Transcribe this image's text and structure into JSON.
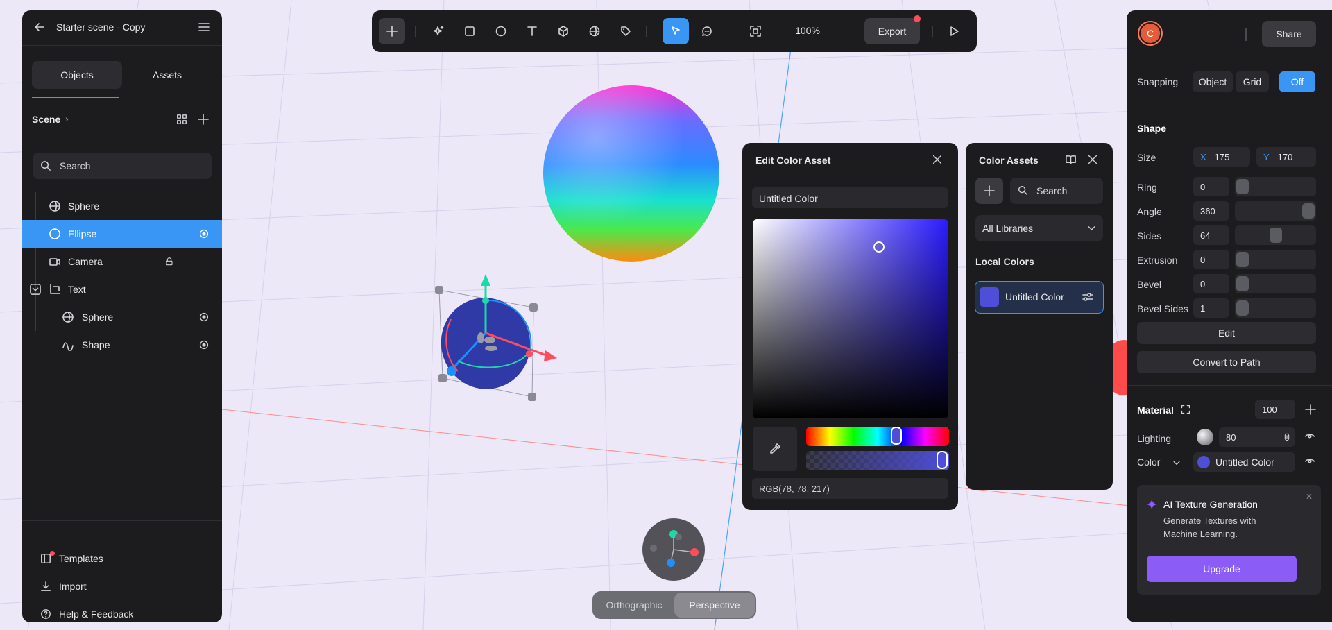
{
  "left_panel": {
    "title": "Starter scene - Copy",
    "tabs": [
      "Objects",
      "Assets"
    ],
    "scene_label": "Scene",
    "search_placeholder": "Search",
    "tree": [
      {
        "label": "Sphere",
        "icon": "sphere-icon"
      },
      {
        "label": "Ellipse",
        "icon": "ellipse-icon"
      },
      {
        "label": "Camera",
        "icon": "camera-icon"
      },
      {
        "label": "Text",
        "icon": "group-icon"
      },
      {
        "label": "Sphere",
        "icon": "sphere-icon"
      },
      {
        "label": "Shape",
        "icon": "shape-icon"
      }
    ],
    "bottom_links": [
      "Templates",
      "Import",
      "Help & Feedback"
    ]
  },
  "toolbar": {
    "zoom": "100%",
    "export_label": "Export"
  },
  "right_panel": {
    "avatar_letter": "C",
    "share_label": "Share",
    "snapping_label": "Snapping",
    "snapping_options": [
      "Object",
      "Grid",
      "Off"
    ],
    "shape_heading": "Shape",
    "size_label": "Size",
    "size_x_label": "X",
    "size_x": "175",
    "size_y_label": "Y",
    "size_y": "170",
    "props": [
      {
        "label": "Ring",
        "value": "0",
        "level": 0
      },
      {
        "label": "Angle",
        "value": "360",
        "level": 1
      },
      {
        "label": "Sides",
        "value": "64",
        "level": 0.5
      },
      {
        "label": "Extrusion",
        "value": "0",
        "level": 0
      },
      {
        "label": "Bevel",
        "value": "0",
        "level": 0
      },
      {
        "label": "Bevel Sides",
        "value": "1",
        "level": 0
      }
    ],
    "edit_label": "Edit",
    "convert_label": "Convert to Path",
    "material_heading": "Material",
    "material_opacity": "100",
    "lighting_label": "Lighting",
    "lighting_value": "80",
    "color_label": "Color",
    "color_value": "Untitled Color",
    "ai_title": "AI Texture Generation",
    "ai_desc": "Generate Textures with Machine Learning.",
    "upgrade_label": "Upgrade"
  },
  "edit_color": {
    "title": "Edit Color Asset",
    "name_value": "Untitled Color",
    "rgb_value": "RGB(78, 78, 217)",
    "color_hex": "#4e4ed9"
  },
  "color_assets": {
    "title": "Color Assets",
    "search_placeholder": "Search",
    "library_select": "All Libraries",
    "local_heading": "Local Colors",
    "local_color_name": "Untitled Color"
  },
  "view_modes": [
    "Orthographic",
    "Perspective"
  ],
  "colors": {
    "accent": "#3a96f5",
    "upgrade": "#8b5cf6",
    "panel": "#1c1c1f"
  }
}
